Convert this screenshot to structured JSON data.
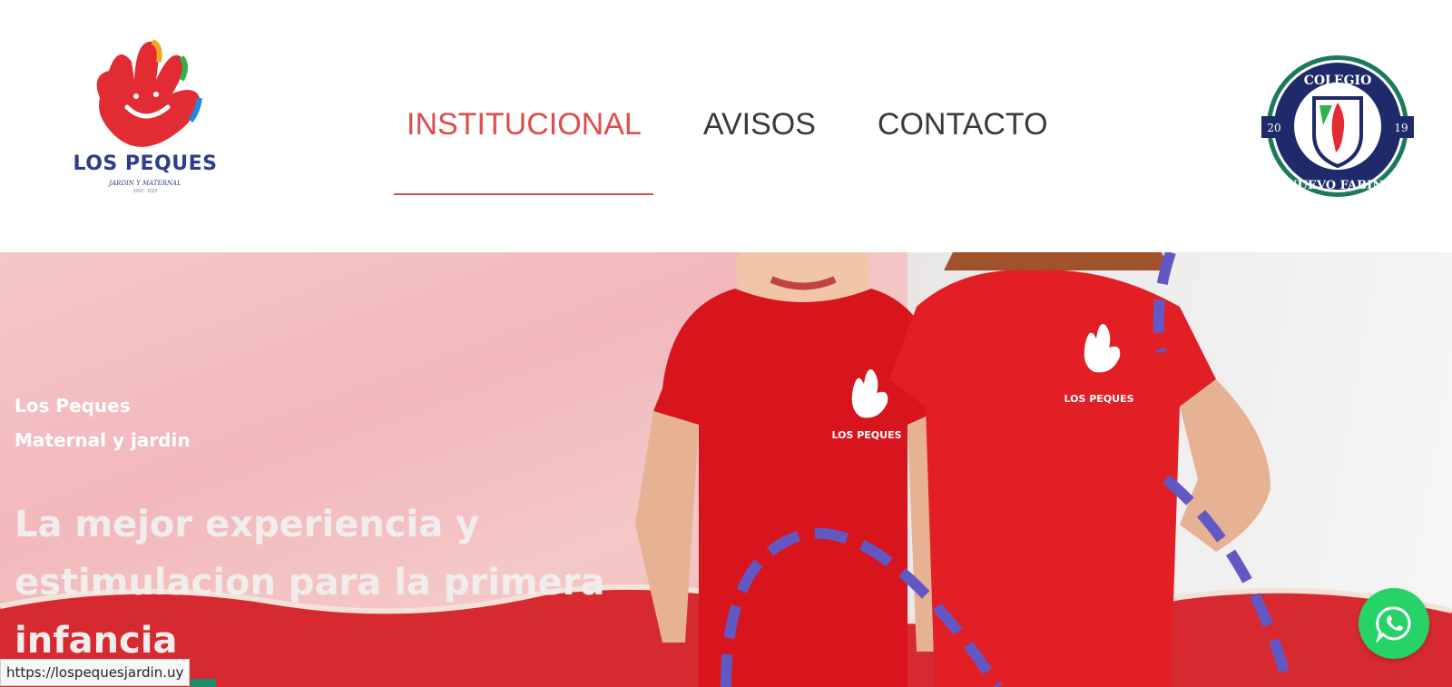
{
  "header": {
    "logo": {
      "brand": "LOS PEQUES",
      "subtitle": "JARDIN Y MATERNAL",
      "years": "1993 · 2023",
      "icon": "hand-logo-icon"
    },
    "nav": [
      {
        "label": "INSTITUCIONAL",
        "active": true
      },
      {
        "label": "AVISOS",
        "active": false
      },
      {
        "label": "CONTACTO",
        "active": false
      }
    ],
    "seal": {
      "top_text": "COLEGIO",
      "bottom_text": "NUEVO FABINI",
      "year_left": "20",
      "year_right": "19",
      "icon": "school-crest-icon"
    },
    "accent_color": "#e04b4b"
  },
  "hero": {
    "brand_line1": "Los Peques",
    "brand_line2": "Maternal y jardin",
    "headline": "La mejor experiencia y estimulacion para la primera infancia",
    "shirt_print": "LOS PEQUES"
  },
  "whatsapp": {
    "icon": "whatsapp-icon",
    "color": "#25d366"
  },
  "status_bar": {
    "url": "https://lospequesjardin.uy"
  }
}
